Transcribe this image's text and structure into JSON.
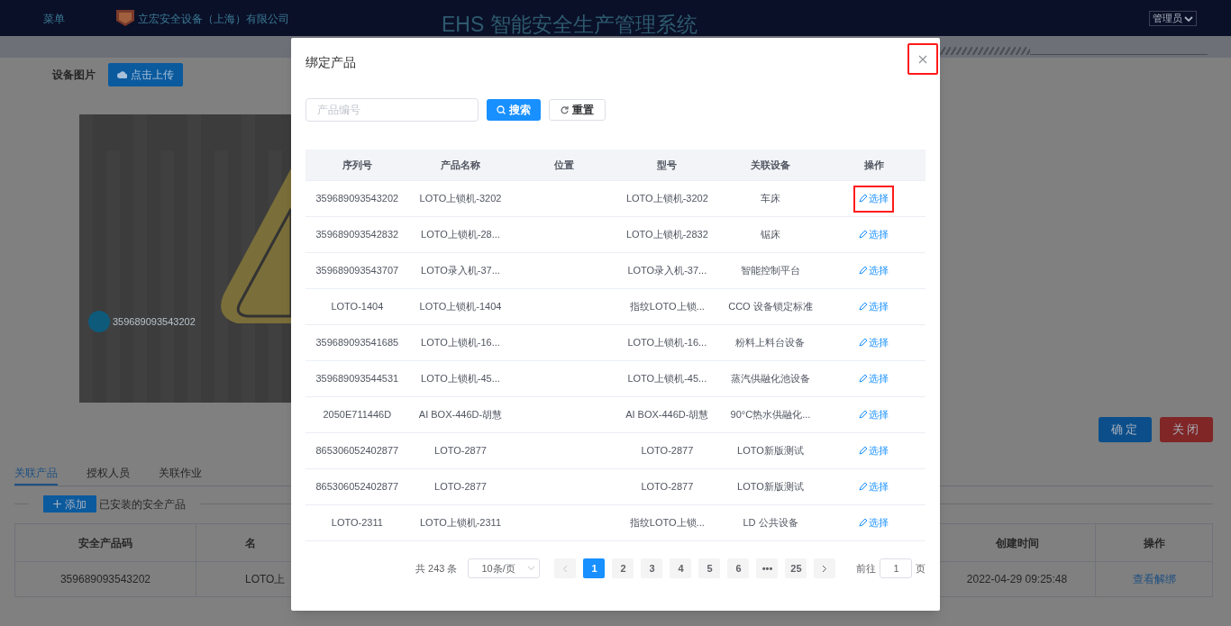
{
  "header": {
    "menu": "菜单",
    "company": "立宏安全设备（上海）有限公司",
    "title": "EHS 智能安全生产管理系统",
    "user": "管理员"
  },
  "device": {
    "image_label": "设备图片",
    "upload_button": "点击上传",
    "marker_label": "359689093543202"
  },
  "form_buttons": [
    "确定",
    "关闭"
  ],
  "tabs": [
    {
      "label": "关联产品",
      "selected": true
    },
    {
      "label": "授权人员",
      "selected": false
    },
    {
      "label": "关联作业",
      "selected": false
    }
  ],
  "section": {
    "add_button": "添加",
    "title": "已安装的安全产品"
  },
  "installed_table": {
    "columns": [
      "安全产品码",
      "名",
      "创建时间",
      "操作"
    ],
    "rows": [
      [
        "359689093543202",
        "LOTO上",
        "2022-04-29 09:25:48",
        "查看解绑"
      ]
    ]
  },
  "dialog": {
    "title": "绑定产品",
    "close_highlighted": true,
    "search": {
      "placeholder": "产品编号",
      "search_button": "搜索",
      "reset_button": "重置"
    },
    "columns": [
      "序列号",
      "产品名称",
      "位置",
      "型号",
      "关联设备",
      "操作"
    ],
    "rows": [
      {
        "cells": [
          "359689093543202",
          "LOTO上锁机-3202",
          "",
          "LOTO上锁机-3202",
          "车床"
        ],
        "action": "选择",
        "highlighted": true
      },
      {
        "cells": [
          "359689093542832",
          "LOTO上锁机-28...",
          "",
          "LOTO上锁机-2832",
          "锯床"
        ],
        "action": "选择",
        "highlighted": false
      },
      {
        "cells": [
          "359689093543707",
          "LOTO录入机-37...",
          "",
          "LOTO录入机-37...",
          "智能控制平台"
        ],
        "action": "选择",
        "highlighted": false
      },
      {
        "cells": [
          "LOTO-1404",
          "LOTO上锁机-1404",
          "",
          "指纹LOTO上锁...",
          "CCO 设备锁定标准"
        ],
        "action": "选择",
        "highlighted": false
      },
      {
        "cells": [
          "359689093541685",
          "LOTO上锁机-16...",
          "",
          "LOTO上锁机-16...",
          "粉料上料台设备"
        ],
        "action": "选择",
        "highlighted": false
      },
      {
        "cells": [
          "359689093544531",
          "LOTO上锁机-45...",
          "",
          "LOTO上锁机-45...",
          "蒸汽供融化池设备"
        ],
        "action": "选择",
        "highlighted": false
      },
      {
        "cells": [
          "2050E711446D",
          "AI BOX-446D-胡慧",
          "",
          "AI BOX-446D-胡慧",
          "90°C热水供融化..."
        ],
        "action": "选择",
        "highlighted": false
      },
      {
        "cells": [
          "865306052402877",
          "LOTO-2877",
          "",
          "LOTO-2877",
          "LOTO新版测试"
        ],
        "action": "选择",
        "highlighted": false
      },
      {
        "cells": [
          "865306052402877",
          "LOTO-2877",
          "",
          "LOTO-2877",
          "LOTO新版测试"
        ],
        "action": "选择",
        "highlighted": false
      },
      {
        "cells": [
          "LOTO-2311",
          "LOTO上锁机-2311",
          "",
          "指纹LOTO上锁...",
          "LD 公共设备"
        ],
        "action": "选择",
        "highlighted": false
      }
    ],
    "pagination": {
      "total": "共 243 条",
      "page_size": "10条/页",
      "pages": [
        {
          "label": "1",
          "selected": true
        },
        {
          "label": "2",
          "selected": false
        },
        {
          "label": "3",
          "selected": false
        },
        {
          "label": "4",
          "selected": false
        },
        {
          "label": "5",
          "selected": false
        },
        {
          "label": "6",
          "selected": false
        },
        {
          "label": "•••",
          "selected": false
        },
        {
          "label": "25",
          "selected": false
        }
      ],
      "goto_label": "前往",
      "goto_value": "1",
      "goto_suffix": "页"
    }
  }
}
